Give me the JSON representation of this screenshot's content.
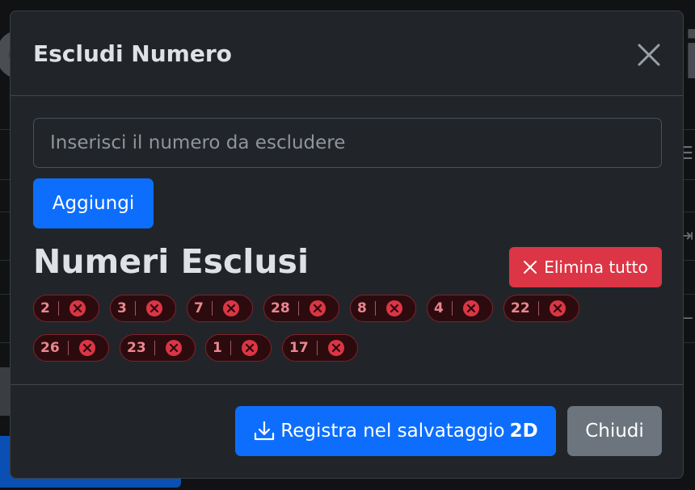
{
  "modal": {
    "title": "Escludi Numero",
    "input_placeholder": "Inserisci il numero da escludere",
    "input_value": "",
    "add_label": "Aggiungi",
    "section_title": "Numeri Esclusi",
    "clear_label": "Elimina tutto",
    "excluded": [
      "2",
      "3",
      "7",
      "28",
      "8",
      "4",
      "22",
      "26",
      "23",
      "1",
      "17"
    ],
    "save_label": "Registra nel salvataggio",
    "save_label_bold": "2D",
    "close_label": "Chiudi"
  },
  "icons": {
    "close": "close-icon",
    "clear": "close-icon",
    "chip_remove": "circle-x-icon",
    "save": "download-icon"
  },
  "colors": {
    "primary": "#0d6efd",
    "danger": "#dc3545",
    "secondary": "#6c757d",
    "chip_bg": "#2c0b0e",
    "chip_text": "#ea868f"
  }
}
